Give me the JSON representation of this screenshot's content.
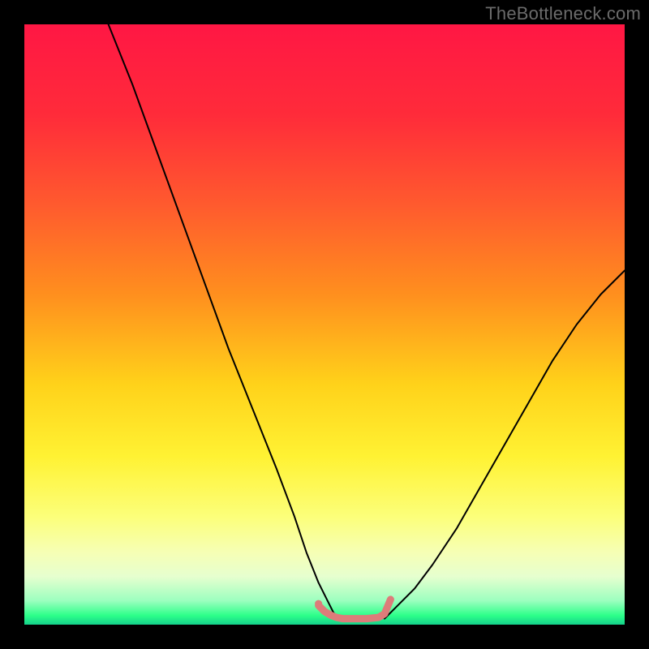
{
  "watermark": "TheBottleneck.com",
  "chart_data": {
    "type": "line",
    "title": "",
    "xlabel": "",
    "ylabel": "",
    "xlim": [
      0,
      100
    ],
    "ylim": [
      0,
      100
    ],
    "grid": false,
    "legend": false,
    "gradient_stops": [
      {
        "offset": 0.0,
        "color": "#ff1744"
      },
      {
        "offset": 0.15,
        "color": "#ff2b3a"
      },
      {
        "offset": 0.3,
        "color": "#ff5a2e"
      },
      {
        "offset": 0.45,
        "color": "#ff8f1e"
      },
      {
        "offset": 0.6,
        "color": "#ffd21a"
      },
      {
        "offset": 0.72,
        "color": "#fff233"
      },
      {
        "offset": 0.82,
        "color": "#fcff7a"
      },
      {
        "offset": 0.88,
        "color": "#f6ffb5"
      },
      {
        "offset": 0.92,
        "color": "#e6ffcf"
      },
      {
        "offset": 0.96,
        "color": "#9cffbf"
      },
      {
        "offset": 0.985,
        "color": "#2cff89"
      },
      {
        "offset": 1.0,
        "color": "#14d18b"
      }
    ],
    "series": [
      {
        "name": "left-curve",
        "color": "#000000",
        "width": 2,
        "x": [
          14,
          18,
          22,
          26,
          30,
          34,
          38,
          42,
          45,
          47,
          49,
          50.5,
          51.5,
          52.5
        ],
        "y": [
          100,
          90,
          79,
          68,
          57,
          46,
          36,
          26,
          18,
          12,
          7,
          4,
          2,
          1
        ]
      },
      {
        "name": "right-curve",
        "color": "#000000",
        "width": 2,
        "x": [
          60,
          62,
          65,
          68,
          72,
          76,
          80,
          84,
          88,
          92,
          96,
          100
        ],
        "y": [
          1,
          3,
          6,
          10,
          16,
          23,
          30,
          37,
          44,
          50,
          55,
          59
        ]
      },
      {
        "name": "bottom-highlight",
        "color": "#dd7c7a",
        "width": 9,
        "x": [
          49,
          50,
          51,
          52,
          53,
          55,
          57,
          59,
          60,
          60.5,
          61
        ],
        "y": [
          3.2,
          2.2,
          1.6,
          1.2,
          1.0,
          1.0,
          1.0,
          1.2,
          1.8,
          3.0,
          4.2
        ]
      }
    ],
    "markers": [
      {
        "name": "left-dot",
        "x": 49,
        "y": 3.5,
        "r": 4.5,
        "color": "#dd7c7a"
      }
    ]
  }
}
